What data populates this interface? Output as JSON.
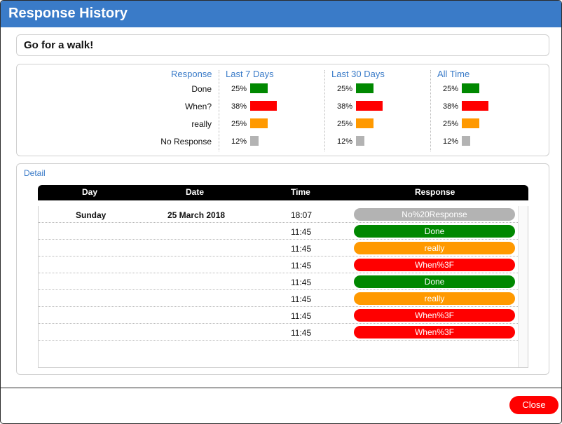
{
  "window": {
    "title": "Response History"
  },
  "heading": "Go for a walk!",
  "summary": {
    "response_header": "Response",
    "periods": [
      {
        "label": "Last 7 Days"
      },
      {
        "label": "Last 30 Days"
      },
      {
        "label": "All Time"
      }
    ],
    "rows": [
      {
        "label": "Done",
        "percent": "25%",
        "fraction": 0.25,
        "color": "#008800"
      },
      {
        "label": "When?",
        "percent": "38%",
        "fraction": 0.38,
        "color": "#ff0000"
      },
      {
        "label": "really",
        "percent": "25%",
        "fraction": 0.25,
        "color": "#ff9900"
      },
      {
        "label": "No Response",
        "percent": "12%",
        "fraction": 0.12,
        "color": "#b3b3b3"
      }
    ]
  },
  "detail": {
    "label": "Detail",
    "columns": [
      "Day",
      "Date",
      "Time",
      "Response"
    ],
    "rows": [
      {
        "day": "Sunday",
        "date": "25 March 2018",
        "time": "18:07",
        "response": "No%20Response",
        "color": "#b3b3b3"
      },
      {
        "day": "",
        "date": "",
        "time": "11:45",
        "response": "Done",
        "color": "#008800"
      },
      {
        "day": "",
        "date": "",
        "time": "11:45",
        "response": "really",
        "color": "#ff9900"
      },
      {
        "day": "",
        "date": "",
        "time": "11:45",
        "response": "When%3F",
        "color": "#ff0000"
      },
      {
        "day": "",
        "date": "",
        "time": "11:45",
        "response": "Done",
        "color": "#008800"
      },
      {
        "day": "",
        "date": "",
        "time": "11:45",
        "response": "really",
        "color": "#ff9900"
      },
      {
        "day": "",
        "date": "",
        "time": "11:45",
        "response": "When%3F",
        "color": "#ff0000"
      },
      {
        "day": "",
        "date": "",
        "time": "11:45",
        "response": "When%3F",
        "color": "#ff0000"
      }
    ]
  },
  "footer": {
    "close_label": "Close"
  }
}
